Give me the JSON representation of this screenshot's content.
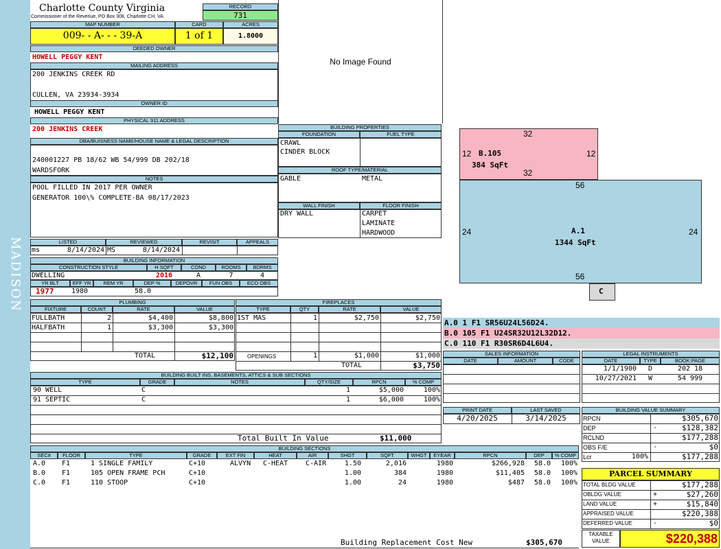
{
  "sidebar": {
    "label": "MADISON"
  },
  "header": {
    "county": "Charlotte County Virginia",
    "subtitle": "Commissioner of the Revenue, PO Box 308, Charlotte CH, VA",
    "record_label": "RECORD",
    "record": "731",
    "map_label": "MAP NUMBER",
    "map_number": "009-  - A-   -   - 39-A",
    "card_label": "CARD",
    "card": "1 of 1",
    "acres_label": "ACRES",
    "acres": "1.8000"
  },
  "owner": {
    "deeded_label": "DEEDED OWNER",
    "deeded": "HOWELL PEGGY KENT",
    "mailing_label": "MAILING ADDRESS",
    "mail1": "200 JENKINS CREEK RD",
    "mail2": "CULLEN, VA 23934-3934",
    "ownerid_label": "OWNER ID",
    "ownerid": "HOWELL PEGGY KENT",
    "phys_label": "PHYSICAL 911 ADDRESS",
    "phys": "200 JENKINS CREEK"
  },
  "legal": {
    "label": "DBA/BUISNESS NAME/HOUSE NAME & LEGAL DESCRIPTION",
    "line1": "240001227 PB 18/62 WB 54/999 DB 202/18",
    "line2": "WARDSFORK"
  },
  "notes": {
    "label": "NOTES",
    "line1": "POOL FILLED IN 2017 PER OWNER",
    "line2": "GENERATOR 100\\% COMPLETE-BA 08/17/2023"
  },
  "review": {
    "listed_label": "LISTED",
    "reviewed_label": "REVIEWED",
    "revisit_label": "REVISIT",
    "appeals_label": "APPEALS",
    "listed_by": "ms",
    "listed_date": "8/14/2024",
    "reviewed_by": "MS",
    "reviewed_date": "8/14/2024"
  },
  "building_info": {
    "label": "BUILDING INFORMATION",
    "cs_label": "CONSTRUCTION STYLE",
    "hsqft_label": "H SQFT",
    "cond_label": "COND",
    "rooms_label": "ROOMS",
    "bdrms_label": "BDRMS",
    "style": "DWELLING",
    "hsqft": "2016",
    "cond": "A",
    "rooms": "7",
    "bdrms": "4",
    "yrblt_label": "YR BLT",
    "effyr_label": "EFF YR",
    "remyr_label": "REM YR",
    "dep_label": "DEP %",
    "depovr_label": "DEPOVR",
    "funobs_label": "FUN OBS",
    "ecoobs_label": "ECO OBS",
    "yrblt": "1977",
    "effyr": "1980",
    "dep": "58.0"
  },
  "image": {
    "text": "No Image Found"
  },
  "building_props": {
    "label": "BUILDING PROPERTIES",
    "foundation_label": "FOUNDATION",
    "fuel_label": "FUEL TYPE",
    "foundation1": "CRAWL",
    "foundation2": "CINDER BLOCK",
    "roof_label": "ROOF TYPE/MATERIAL",
    "roof_type": "GABLE",
    "roof_material": "METAL",
    "wall_label": "WALL FINISH",
    "floor_label": "FLOOR FINISH",
    "wall": "DRY WALL",
    "floor1": "CARPET",
    "floor2": "LAMINATE",
    "floor3": "HARDWOOD"
  },
  "sketch": {
    "b_top": "32",
    "b_left": "12",
    "b_right": "12",
    "b_bottom": "32",
    "b_name": "B.105",
    "b_area": "384 SqFt",
    "a_top": "56",
    "a_left": "24",
    "a_right": "24",
    "a_bottom": "56",
    "a_name": "A.1",
    "a_area": "1344 SqFt",
    "c_name": "C",
    "colors": {
      "b": "#f7b6c2",
      "a": "#acd4e3",
      "c": "#d9d9d9"
    }
  },
  "codes": [
    {
      "text": "A.0  1    F1  SR56U24L56D24."
    },
    {
      "text": "B.0  105  F1  U24SR32U12L32D12."
    },
    {
      "text": "C.0  110  F1  R30SR6D4L6U4."
    }
  ],
  "plumbing": {
    "label": "PLUMBING",
    "h_fixture": "FIXTURE",
    "h_count": "COUNT",
    "h_rate": "RATE",
    "h_value": "VALUE",
    "rows": [
      {
        "fixture": "FULLBATH",
        "count": "2",
        "rate": "$4,400",
        "value": "$8,800"
      },
      {
        "fixture": "HALFBATH",
        "count": "1",
        "rate": "$3,300",
        "value": "$3,300"
      }
    ],
    "total_label": "TOTAL",
    "total": "$12,100"
  },
  "fireplaces": {
    "label": "FIREPLACES",
    "h_type": "TYPE",
    "h_qty": "QTY",
    "h_rate": "RATE",
    "h_value": "VALUE",
    "rows": [
      {
        "type": "1ST MAS",
        "qty": "1",
        "rate": "$2,750",
        "value": "$2,750"
      }
    ],
    "openings_label": "OPENINGS",
    "openings_qty": "1",
    "openings_rate": "$1,000",
    "openings_value": "$1,000",
    "total_label": "TOTAL",
    "total": "$3,750"
  },
  "builtins": {
    "label": "BUILDING BUILT INS, BASEMENTS, ATTICS & SUB SECTIONS",
    "h_type": "TYPE",
    "h_grade": "GRADE",
    "h_notes": "NOTES",
    "h_qty": "QTY/SIZE",
    "h_rpcn": "RPCN",
    "h_comp": "% COMP",
    "rows": [
      {
        "type": "90 WELL",
        "grade": "C",
        "qty": "1",
        "rpcn": "$5,000",
        "comp": "100%"
      },
      {
        "type": "91 SEPTIC",
        "grade": "C",
        "qty": "1",
        "rpcn": "$6,000",
        "comp": "100%"
      }
    ],
    "total_label": "Total Built In Value",
    "total": "$11,000"
  },
  "sales": {
    "label": "SALES INFORMATION",
    "h_date": "DATE",
    "h_amount": "AMOUNT",
    "h_code": "CODE"
  },
  "legal_instruments": {
    "label": "LEGAL INSTRUMENTS",
    "h_date": "DATE",
    "h_type": "TYPE",
    "h_book": "BOOK:PAGE",
    "rows": [
      {
        "date": "1/1/1900",
        "type": "D",
        "book": "202 18"
      },
      {
        "date": "10/27/2021",
        "type": "W",
        "book": "54 999"
      }
    ]
  },
  "print": {
    "print_label": "PRINT DATE",
    "saved_label": "LAST SAVED",
    "print_date": "4/20/2025",
    "saved_date": "3/14/2025"
  },
  "bvs": {
    "label": "BUILDING VALUE SUMMARY",
    "rows": [
      {
        "label": "RPCN",
        "sign": "",
        "value": "$305,670"
      },
      {
        "label": "DEP",
        "sign": "-",
        "value": "$128,382"
      },
      {
        "label": "RCLND",
        "sign": "",
        "value": "$177,288"
      },
      {
        "label": "OBS F/E",
        "sign": "-",
        "value": "$0"
      },
      {
        "label": "Lcr",
        "pct": "100%",
        "sign": "",
        "value": "$177,288"
      }
    ]
  },
  "parcel": {
    "label": "PARCEL SUMMARY",
    "rows": [
      {
        "label": "TOTAL BLDG VALUE",
        "sign": "",
        "value": "$177,288"
      },
      {
        "label": "OBLDG VALUE",
        "sign": "+",
        "value": "$27,260"
      },
      {
        "label": "LAND VALUE",
        "sign": "+",
        "value": "$15,840"
      },
      {
        "label": "APPRAISED VALUE",
        "sign": "",
        "value": "$220,388"
      },
      {
        "label": "DEFERRED VALUE",
        "sign": "-",
        "value": "$0"
      }
    ],
    "taxable_label1": "TAXABLE",
    "taxable_label2": "VALUE",
    "taxable": "$220,388"
  },
  "sections": {
    "label": "BUILDING SECTIONS",
    "headers": [
      "SEC#",
      "FLOOR",
      "TYPE",
      "GRADE",
      "EXT FIN",
      "HEAT",
      "AIR",
      "SHGT",
      "SQFT",
      "WHGT",
      "EYEAR",
      "RPCN",
      "DEP",
      "% COMP"
    ],
    "rows": [
      {
        "sec": "A.0",
        "floor": "F1",
        "type": "1 SINGLE FAMILY",
        "grade": "C+10",
        "ext": "ALVYN",
        "heat": "C-HEAT",
        "air": "C-AIR",
        "shgt": "1.50",
        "sqft": "2,016",
        "eyear": "1980",
        "rpcn": "$266,928",
        "dep": "58.0",
        "comp": "100%"
      },
      {
        "sec": "B.0",
        "floor": "F1",
        "type": "105 OPEN FRAME PCH",
        "grade": "C+10",
        "ext": "",
        "heat": "",
        "air": "",
        "shgt": "1.00",
        "sqft": "384",
        "eyear": "1980",
        "rpcn": "$11,405",
        "dep": "58.0",
        "comp": "100%"
      },
      {
        "sec": "C.0",
        "floor": "F1",
        "type": "110 STOOP",
        "grade": "C+10",
        "ext": "",
        "heat": "",
        "air": "",
        "shgt": "1.00",
        "sqft": "24",
        "eyear": "1980",
        "rpcn": "$487",
        "dep": "58.0",
        "comp": "100%"
      }
    ],
    "brcn_label": "Building Replacement Cost New",
    "brcn": "$305,670"
  }
}
